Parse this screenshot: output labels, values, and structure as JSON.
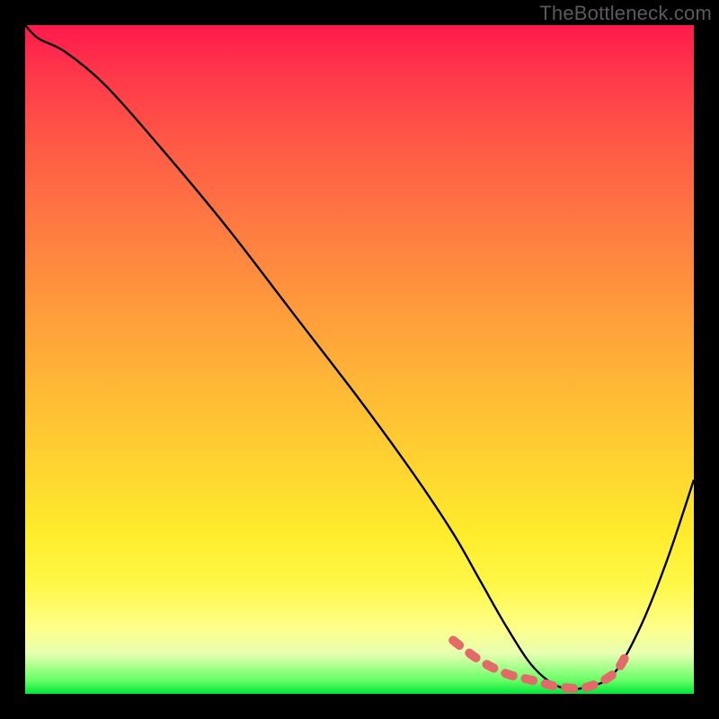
{
  "watermark": "TheBottleneck.com",
  "chart_data": {
    "type": "line",
    "title": "",
    "xlabel": "",
    "ylabel": "",
    "xlim": [
      0,
      100
    ],
    "ylim": [
      0,
      100
    ],
    "series": [
      {
        "name": "bottleneck-curve",
        "x": [
          0,
          2,
          6,
          12,
          20,
          30,
          40,
          50,
          58,
          64,
          68,
          72,
          76,
          80,
          84,
          88,
          92,
          96,
          100
        ],
        "y": [
          100,
          98,
          96,
          91,
          82,
          70,
          57,
          44,
          33,
          24,
          17,
          10,
          4,
          1,
          1,
          3,
          10,
          20,
          32
        ]
      }
    ],
    "highlight_segment": {
      "name": "optimal-zone",
      "x": [
        64,
        68,
        72,
        76,
        80,
        84,
        88,
        90
      ],
      "y": [
        8,
        5,
        3,
        2,
        1,
        1,
        3,
        6
      ]
    },
    "gradient": {
      "direction": "vertical",
      "stops": [
        {
          "pos": 0.0,
          "color": "#ff1a4d"
        },
        {
          "pos": 0.3,
          "color": "#ff7a42"
        },
        {
          "pos": 0.66,
          "color": "#ffd430"
        },
        {
          "pos": 0.9,
          "color": "#ffff88"
        },
        {
          "pos": 1.0,
          "color": "#00e63a"
        }
      ]
    }
  }
}
